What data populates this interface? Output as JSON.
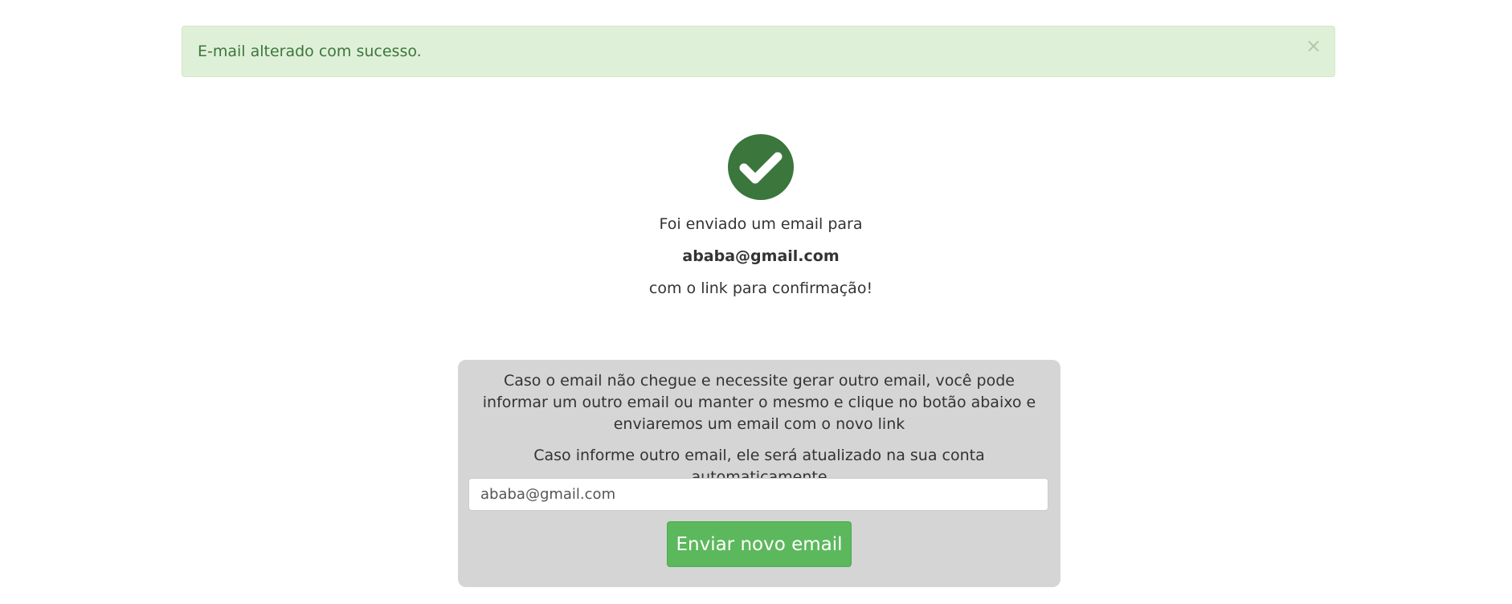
{
  "alert": {
    "message": "E-mail alterado com sucesso.",
    "close_symbol": "×",
    "background_color": "#dff0d8",
    "text_color": "#3c763d"
  },
  "status_icon": {
    "name": "check-circle-icon",
    "color": "#3b763d"
  },
  "confirmation": {
    "line1": "Foi enviado um email para",
    "email": "ababa@gmail.com",
    "line3": "com o link para confirmação!"
  },
  "resend_panel": {
    "instructions": "Caso o email não chegue e necessite gerar outro email, você pode informar um outro email ou manter o mesmo e clique no botão abaixo e enviaremos um email com o novo link",
    "note": "Caso informe outro email, ele será atualizado na sua conta automaticamente",
    "email_value": "ababa@gmail.com",
    "button_label": "Enviar novo email",
    "button_color": "#5cb85c",
    "panel_color": "#d5d5d5"
  }
}
